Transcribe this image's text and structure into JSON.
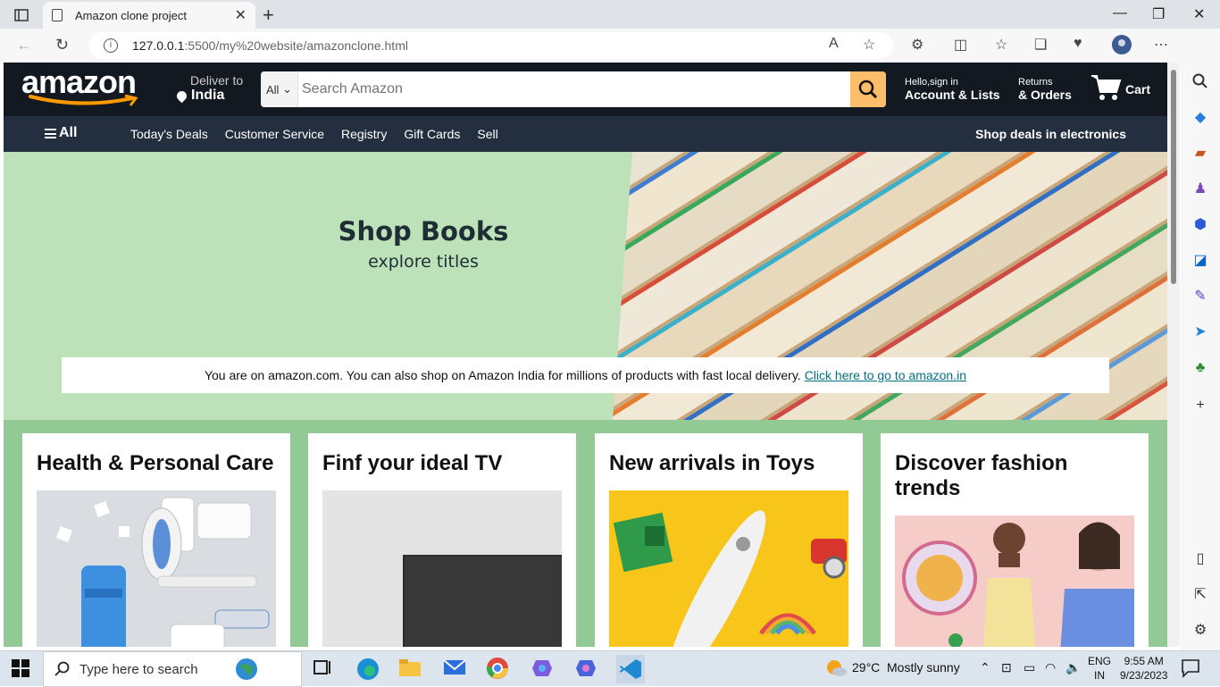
{
  "browser": {
    "tab_title": "Amazon clone project",
    "url_host": "127.0.0.1",
    "url_path": ":5500/my%20website/amazonclone.html"
  },
  "header": {
    "logo_text": "amazon",
    "deliver_label": "Deliver to",
    "deliver_location": "India",
    "search_category": "All",
    "search_placeholder": "Search Amazon",
    "account_small": "Hello,sign in",
    "account_big": "Account & Lists",
    "orders_small": "Returns",
    "orders_big": "& Orders",
    "cart_label": "Cart"
  },
  "nav": {
    "all_label": "All",
    "links": [
      "Today's Deals",
      "Customer Service",
      "Registry",
      "Gift Cards",
      "Sell"
    ],
    "deals_label": "Shop deals in electronics"
  },
  "hero": {
    "title": "Shop Books",
    "subtitle": "explore titles",
    "notice_text": "You are on amazon.com. You can also shop on Amazon India for millions of products with fast local delivery.",
    "notice_link": "Click here to go to amazon.in"
  },
  "boxes": [
    {
      "title": "Health & Personal Care"
    },
    {
      "title": "Finf your ideal TV"
    },
    {
      "title": "New arrivals in Toys"
    },
    {
      "title": "Discover fashion trends"
    }
  ],
  "taskbar": {
    "search_placeholder": "Type here to search",
    "weather_temp": "29°C",
    "weather_text": "Mostly sunny",
    "lang_top": "ENG",
    "lang_bottom": "IN",
    "time": "9:55 AM",
    "date": "9/23/2023"
  },
  "colors": {
    "amazon_dark": "#131921",
    "amazon_nav": "#232f3e",
    "search_button": "#febd69",
    "hero_bg": "#bde2b9",
    "boxes_bg": "#93c994",
    "link": "#007185"
  }
}
